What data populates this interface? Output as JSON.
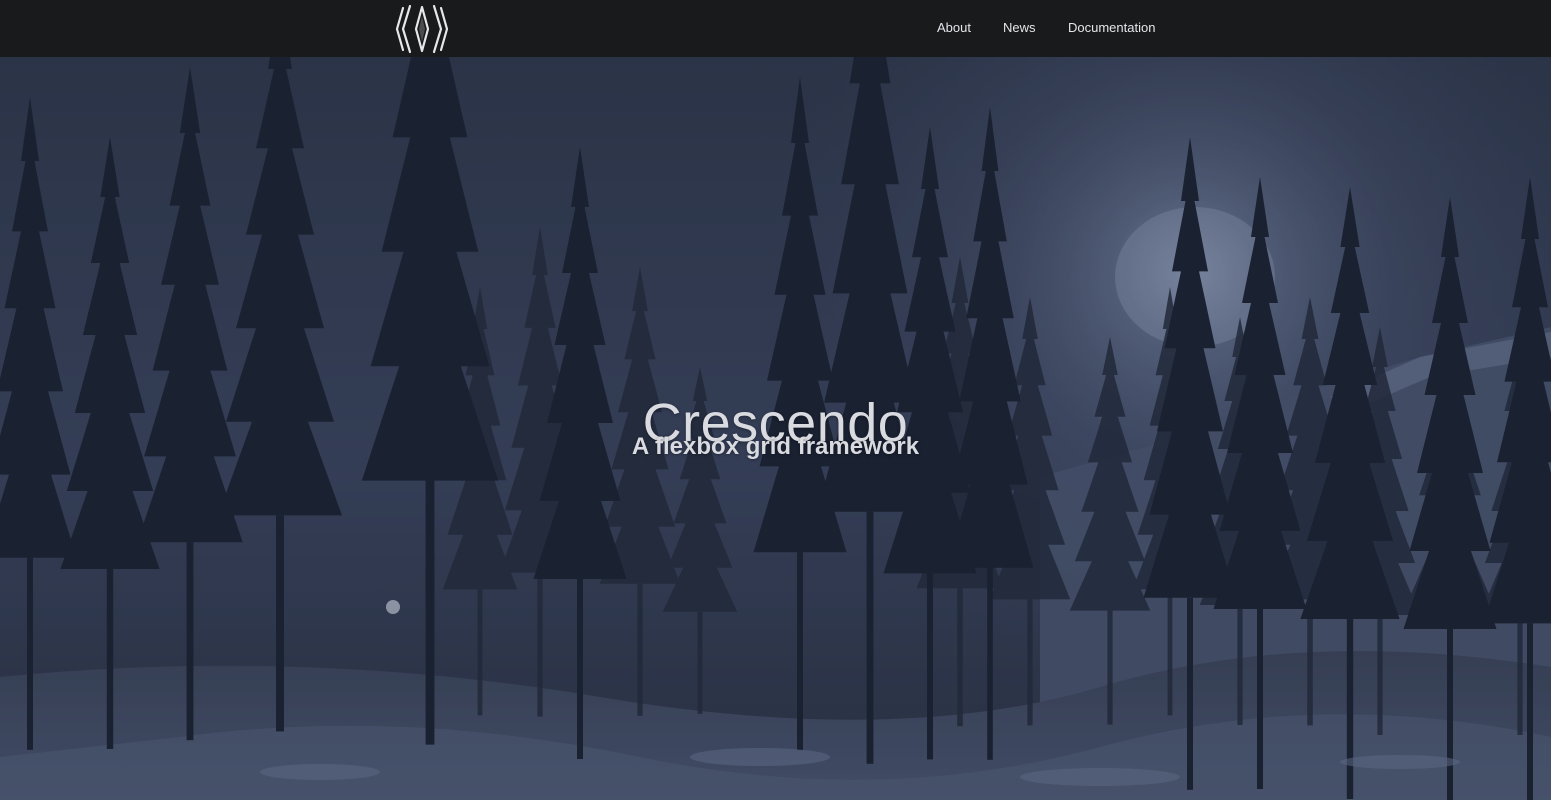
{
  "navbar": {
    "logo_icon": "crescendo-logo-icon",
    "links": [
      {
        "label": "About"
      },
      {
        "label": "News"
      },
      {
        "label": "Documentation"
      }
    ]
  },
  "hero": {
    "title": "Crescendo",
    "subtitle": "A flexbox grid framework",
    "background_image": "snowy-pine-forest-night-sky",
    "colors": {
      "navbar_bg": "#181a1c",
      "sky": "#353e55",
      "text": "#d9dbe0"
    }
  }
}
